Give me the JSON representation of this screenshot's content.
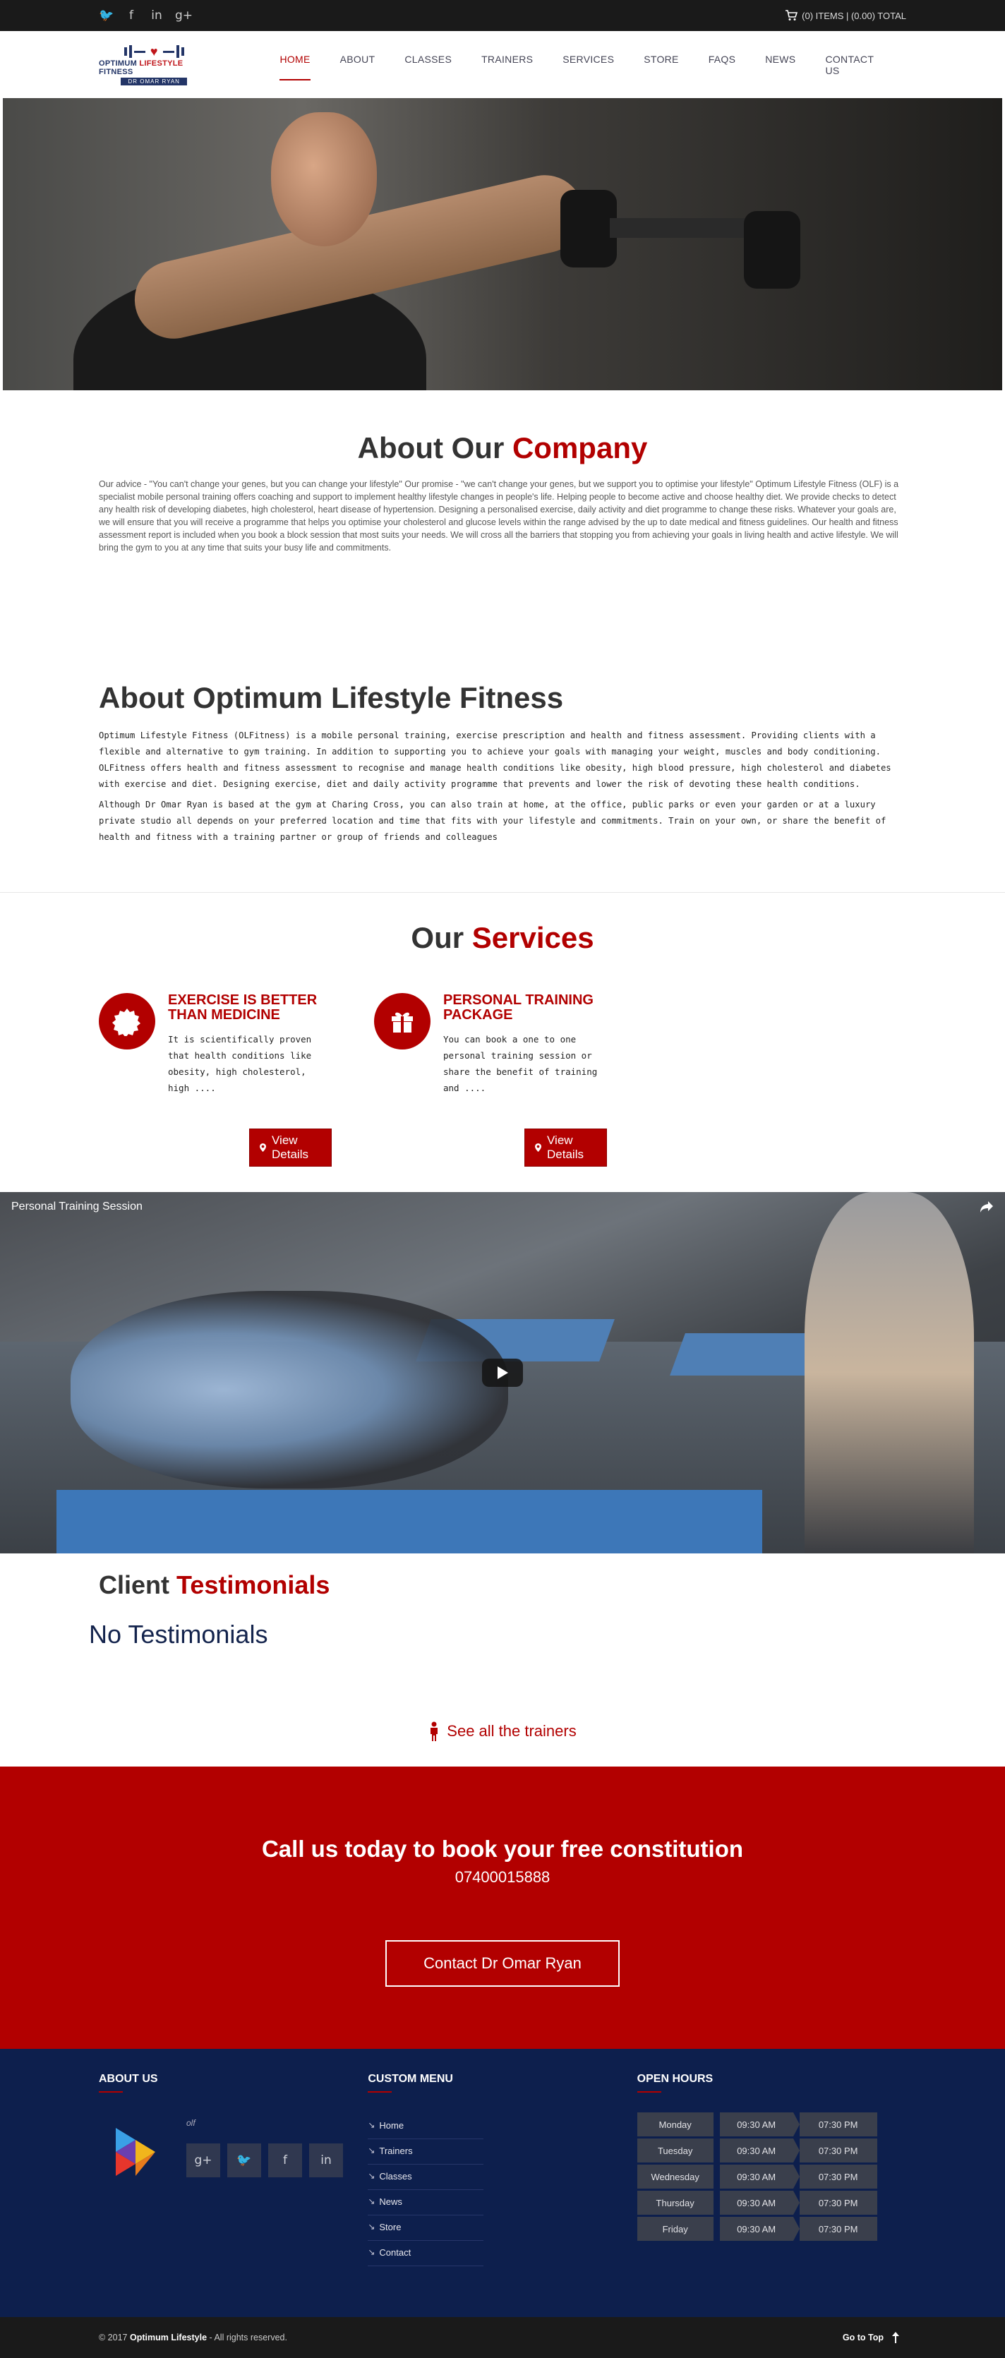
{
  "topbar": {
    "social_icons": [
      "twitter-icon",
      "facebook-icon",
      "linkedin-icon",
      "google-plus-icon"
    ],
    "social_glyphs": [
      "🐦",
      "f",
      "in",
      "g+"
    ],
    "cart_text": "(0) ITEMS | (0.00) TOTAL"
  },
  "logo": {
    "line1_a": "OPTIMUM",
    "line1_b": "LIFESTYLE",
    "line1_c": "FITNESS",
    "line2": "DR OMAR RYAN"
  },
  "nav": {
    "items": [
      "HOME",
      "ABOUT",
      "CLASSES",
      "TRAINERS",
      "SERVICES",
      "STORE",
      "FAQS",
      "NEWS",
      "CONTACT US"
    ],
    "active": "HOME"
  },
  "about_company": {
    "title_a": "About Our",
    "title_b": "Company",
    "text": "Our advice - \"You can't change your genes, but you can change your lifestyle\" Our promise - \"we can't change your genes, but we support you to optimise your lifestyle\" Optimum Lifestyle Fitness (OLF) is a specialist mobile personal training offers coaching and support to implement healthy lifestyle changes in people's life. Helping people to become active and choose healthy diet. We provide checks to detect any health risk of developing diabetes, high cholesterol, heart disease of hypertension. Designing a personalised exercise, daily activity and diet programme to change these risks. Whatever your goals are, we will ensure that you will receive a programme that helps you optimise your cholesterol and glucose levels within the range advised by the up to date medical and fitness guidelines. Our health and fitness assessment report is included when you book a block session that most suits your needs. We will cross all the barriers that stopping you from achieving your goals in living health and active lifestyle. We will bring the gym to you at any time that suits your busy life and commitments."
  },
  "about_olf": {
    "title": "About Optimum Lifestyle Fitness",
    "para1": "Optimum Lifestyle Fitness (OLFitness) is a mobile personal training, exercise prescription and health and fitness assessment. Providing clients with a flexible and alternative to gym training. In addition to supporting you to achieve your goals with managing your weight, muscles and body conditioning. OLFitness offers health and fitness assessment to recognise and manage health conditions like obesity, high blood pressure, high cholesterol and diabetes with exercise and diet. Designing exercise, diet and daily activity programme that prevents and lower the risk of  devoting these health conditions.",
    "para2": "Although Dr Omar Ryan is based at the gym at Charing Cross, you can also train at home, at the office, public parks or even your garden or at a luxury private studio all depends on your preferred location and time that fits with your lifestyle and commitments. Train on your own, or share the benefit of health and fitness with a training partner or group of friends and colleagues"
  },
  "services": {
    "title_a": "Our",
    "title_b": "Services",
    "items": [
      {
        "icon": "badge-icon",
        "title": "EXERCISE IS BETTER THAN MEDICINE",
        "text": "It is scientifically proven that health conditions like obesity, high cholesterol, high ....",
        "button": "View Details"
      },
      {
        "icon": "gift-icon",
        "title": "PERSONAL TRAINING PACKAGE",
        "text": "You can book a one to one personal training session or share the benefit of training and ....",
        "button": "View Details"
      }
    ]
  },
  "video": {
    "title": "Personal Training Session"
  },
  "testimonials": {
    "title_a": "Client",
    "title_b": "Testimonials",
    "empty": "No Testimonials",
    "link": "See all the trainers"
  },
  "cta": {
    "heading": "Call us today to book your free constitution",
    "phone": "07400015888",
    "button": "Contact Dr Omar Ryan"
  },
  "footer": {
    "about_title": "ABOUT US",
    "about_caption": "olf",
    "social_glyphs": [
      "g+",
      "🐦",
      "f",
      "in"
    ],
    "menu_title": "CUSTOM MENU",
    "menu_items": [
      "Home",
      "Trainers",
      "Classes",
      "News",
      "Store",
      "Contact"
    ],
    "hours_title": "OPEN HOURS",
    "hours": [
      {
        "day": "Monday",
        "open": "09:30 AM",
        "close": "07:30 PM"
      },
      {
        "day": "Tuesday",
        "open": "09:30 AM",
        "close": "07:30 PM"
      },
      {
        "day": "Wednesday",
        "open": "09:30 AM",
        "close": "07:30 PM"
      },
      {
        "day": "Thursday",
        "open": "09:30 AM",
        "close": "07:30 PM"
      },
      {
        "day": "Friday",
        "open": "09:30 AM",
        "close": "07:30 PM"
      }
    ]
  },
  "bottom": {
    "copyright_prefix": "© 2017",
    "brand": "Optimum Lifestyle",
    "copyright_suffix": "- All rights reserved.",
    "go_top": "Go to Top"
  },
  "colors": {
    "brand_red": "#b20000",
    "navy": "#0d1f4d",
    "dark": "#1a1a1a"
  }
}
